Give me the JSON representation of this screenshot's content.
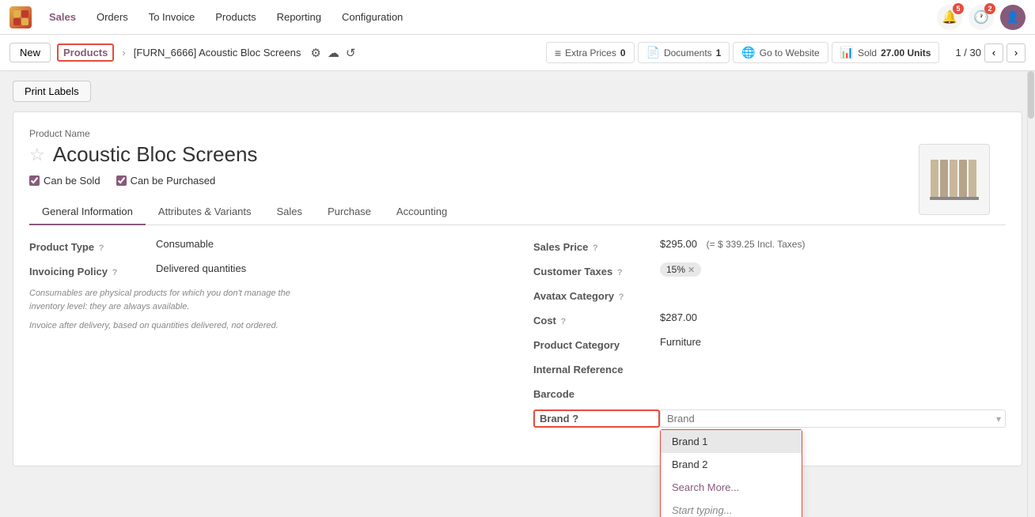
{
  "navbar": {
    "logo_text": "O",
    "items": [
      {
        "label": "Sales",
        "active": true
      },
      {
        "label": "Orders",
        "active": false
      },
      {
        "label": "To Invoice",
        "active": false
      },
      {
        "label": "Products",
        "active": false
      },
      {
        "label": "Reporting",
        "active": false
      },
      {
        "label": "Configuration",
        "active": false
      }
    ],
    "icons": {
      "bell": "🔔",
      "bell_badge": "5",
      "clock": "🕐",
      "clock_badge": "2"
    }
  },
  "actionbar": {
    "new_label": "New",
    "breadcrumb_link": "Products",
    "breadcrumb_current": "[FURN_6666] Acoustic Bloc Screens",
    "toolbar": [
      {
        "icon": "≡",
        "label": "Extra Prices",
        "count": "0"
      },
      {
        "icon": "📄",
        "label": "Documents",
        "count": "1"
      },
      {
        "icon": "🌐",
        "label": "Go to Website",
        "count": null
      },
      {
        "icon": "📊",
        "label": "Sold",
        "count": "27.00 Units"
      }
    ],
    "pager": "1 / 30"
  },
  "print_labels": "Print Labels",
  "form": {
    "product_name_label": "Product Name",
    "product_title": "Acoustic Bloc Screens",
    "can_be_sold": "Can be Sold",
    "can_be_purchased": "Can be Purchased",
    "tabs": [
      {
        "label": "General Information",
        "active": true
      },
      {
        "label": "Attributes & Variants",
        "active": false
      },
      {
        "label": "Sales",
        "active": false
      },
      {
        "label": "Purchase",
        "active": false
      },
      {
        "label": "Accounting",
        "active": false
      }
    ],
    "left_fields": {
      "product_type_label": "Product Type",
      "product_type_help": "?",
      "product_type_value": "Consumable",
      "invoicing_policy_label": "Invoicing Policy",
      "invoicing_policy_help": "?",
      "invoicing_policy_value": "Delivered quantities",
      "note1": "Consumables are physical products for which you don't manage the",
      "note2": "inventory level: they are always available.",
      "note3": "Invoice after delivery, based on quantities delivered, not ordered."
    },
    "right_fields": {
      "sales_price_label": "Sales Price",
      "sales_price_help": "?",
      "sales_price_value": "$295.00",
      "sales_price_incl": "(= $ 339.25 Incl. Taxes)",
      "customer_taxes_label": "Customer Taxes",
      "customer_taxes_help": "?",
      "customer_taxes_badge": "15%",
      "avatax_label": "Avatax Category",
      "avatax_help": "?",
      "cost_label": "Cost",
      "cost_help": "?",
      "cost_value": "$287.00",
      "product_category_label": "Product Category",
      "product_category_value": "Furniture",
      "internal_ref_label": "Internal Reference",
      "barcode_label": "Barcode",
      "brand_label": "Brand",
      "brand_help": "?",
      "brand_placeholder": "Brand"
    },
    "brand_dropdown": {
      "items": [
        {
          "label": "Brand 1",
          "type": "highlighted"
        },
        {
          "label": "Brand 2",
          "type": "normal"
        },
        {
          "label": "Search More...",
          "type": "link"
        },
        {
          "label": "Start typing...",
          "type": "italic"
        }
      ]
    }
  }
}
